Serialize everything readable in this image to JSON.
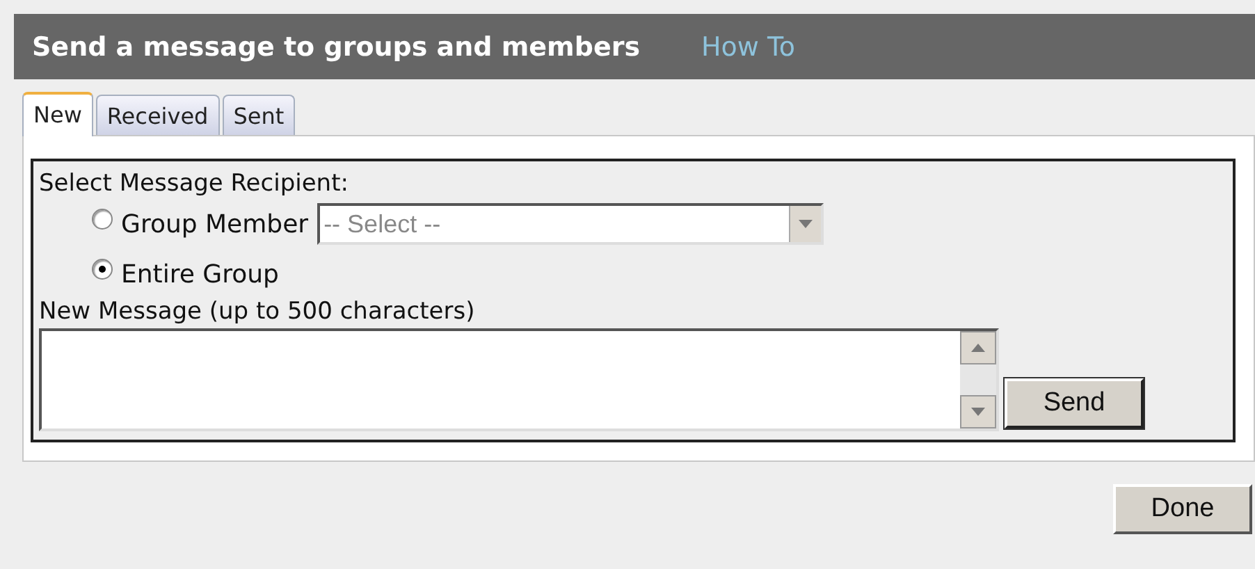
{
  "header": {
    "title": "Send a message to groups and members",
    "link": "How To"
  },
  "tabs": [
    {
      "label": "New",
      "selected": true
    },
    {
      "label": "Received",
      "selected": false
    },
    {
      "label": "Sent",
      "selected": false
    }
  ],
  "recipient": {
    "label": "Select Message Recipient:",
    "options": [
      {
        "label": "Group Member",
        "selected": false,
        "kind": "select",
        "select": {
          "value": "-- Select --",
          "disabled": true
        }
      },
      {
        "label": "Entire Group",
        "selected": true,
        "kind": "plain"
      }
    ]
  },
  "message": {
    "label": "New Message (up to 500 characters)",
    "send": "Send"
  },
  "done": "Done"
}
